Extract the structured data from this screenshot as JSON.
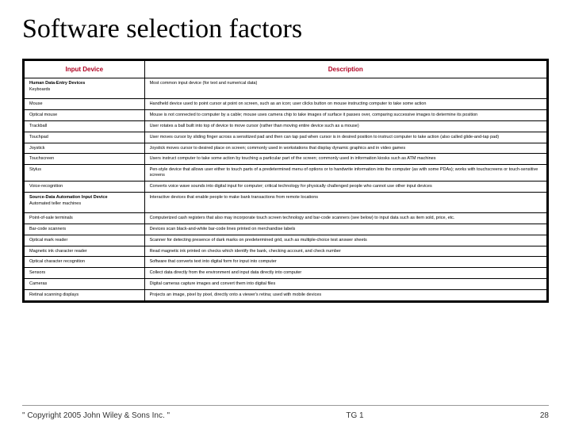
{
  "title": "Software selection factors",
  "headers": {
    "col1": "Input Device",
    "col2": "Description"
  },
  "sections": {
    "human": "Human Data-Entry Devices",
    "source": "Source-Data Automation Input Device"
  },
  "rows": [
    {
      "section": "human",
      "name": "Keyboards",
      "desc": "Most common input device (for text and numerical data)"
    },
    {
      "name": "Mouse",
      "desc": "Handheld device used to point cursor at point on screen, such as an icon; user clicks button on mouse instructing computer to take some action"
    },
    {
      "name": "Optical mouse",
      "desc": "Mouse is not connected to computer by a cable; mouse uses camera chip to take images of surface it passes over, comparing successive images to determine its position"
    },
    {
      "name": "Trackball",
      "desc": "User rotates a ball built into top of device to move cursor (rather than moving entire device such as a mouse)"
    },
    {
      "name": "Touchpad",
      "desc": "User moves cursor by sliding finger across a sensitized pad and then can tap pad when cursor is in desired position to instruct computer to take action (also called glide-and-tap pad)"
    },
    {
      "name": "Joystick",
      "desc": "Joystick moves cursor to desired place on screen; commonly used in workstations that display dynamic graphics and in video games"
    },
    {
      "name": "Touchscreen",
      "desc": "Users instruct computer to take some action by touching a particular part of the screen; commonly used in information kiosks such as ATM machines"
    },
    {
      "name": "Stylus",
      "desc": "Pen-style device that allows user either to touch parts of a predetermined menu of options or to handwrite information into the computer (as with some PDAs); works with touchscreens or touch-sensitive screens"
    },
    {
      "name": "Voice-recognition",
      "desc": "Converts voice wave sounds into digital input for computer; critical technology for physically challenged people who cannot use other input devices"
    },
    {
      "section": "source",
      "name": "Automated teller machines",
      "desc": "Interactive devices that enable people to make bank transactions from remote locations"
    },
    {
      "name": "Point-of-sale terminals",
      "desc": "Computerized cash registers that also may incorporate touch screen technology and bar-code scanners (see below) to input data such as item sold, price, etc."
    },
    {
      "name": "Bar-code scanners",
      "desc": "Devices scan black-and-white bar-code lines printed on merchandise labels"
    },
    {
      "name": "Optical mark reader",
      "desc": "Scanner for detecting presence of dark marks on predetermined grid, such as multiple-choice test answer sheets"
    },
    {
      "name": "Magnetic ink character reader",
      "desc": "Read magnetic ink printed on checks which identify the bank, checking account, and check number"
    },
    {
      "name": "Optical character recognition",
      "desc": "Software that converts text into digital form for input into computer"
    },
    {
      "name": "Sensors",
      "desc": "Collect data directly from the environment and input data directly into computer"
    },
    {
      "name": "Cameras",
      "desc": "Digital cameras capture images and convert them into digital files"
    },
    {
      "name": "Retinal scanning displays",
      "desc": "Projects an image, pixel by pixel, directly onto a viewer's retina; used with mobile devices"
    }
  ],
  "footer": {
    "copyright": "\" Copyright 2005 John Wiley & Sons Inc. \"",
    "center": "TG 1",
    "page": "28"
  }
}
